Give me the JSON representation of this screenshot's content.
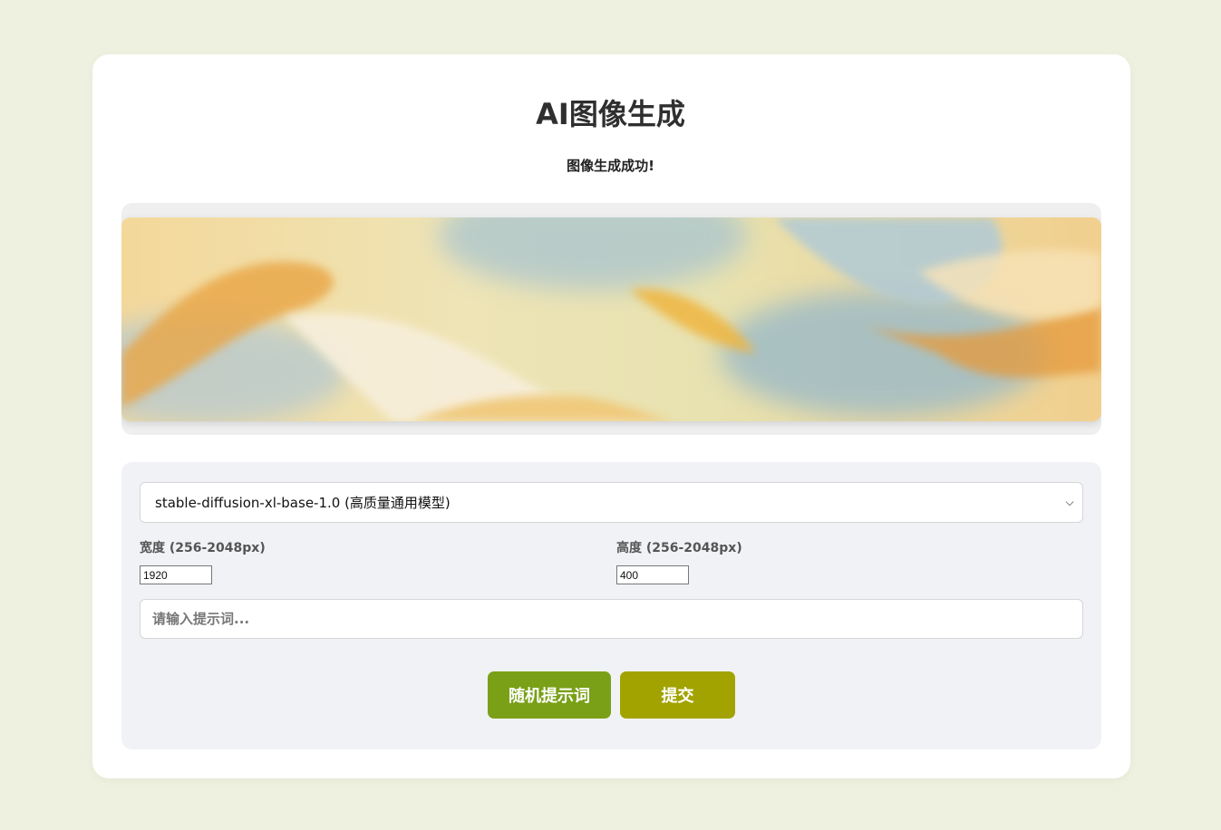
{
  "page": {
    "title": "AI图像生成",
    "status_message": "图像生成成功!"
  },
  "image": {
    "description": "generated image",
    "palette": [
      "#f3c86a",
      "#e8a03c",
      "#a9c4cf",
      "#f6ecd7",
      "#e9e6b8"
    ]
  },
  "form": {
    "model_select": {
      "selected": "stable-diffusion-xl-base-1.0 (高质量通用模型)"
    },
    "width": {
      "label": "宽度 (256-2048px)",
      "value": "1920"
    },
    "height": {
      "label": "高度 (256-2048px)",
      "value": "400"
    },
    "prompt": {
      "placeholder": "请输入提示词...",
      "value": ""
    },
    "random_button_label": "随机提示词",
    "submit_button_label": "提交"
  },
  "colors": {
    "background": "#eef1df",
    "random_button": "#7aa017",
    "submit_button": "#a2a300"
  }
}
